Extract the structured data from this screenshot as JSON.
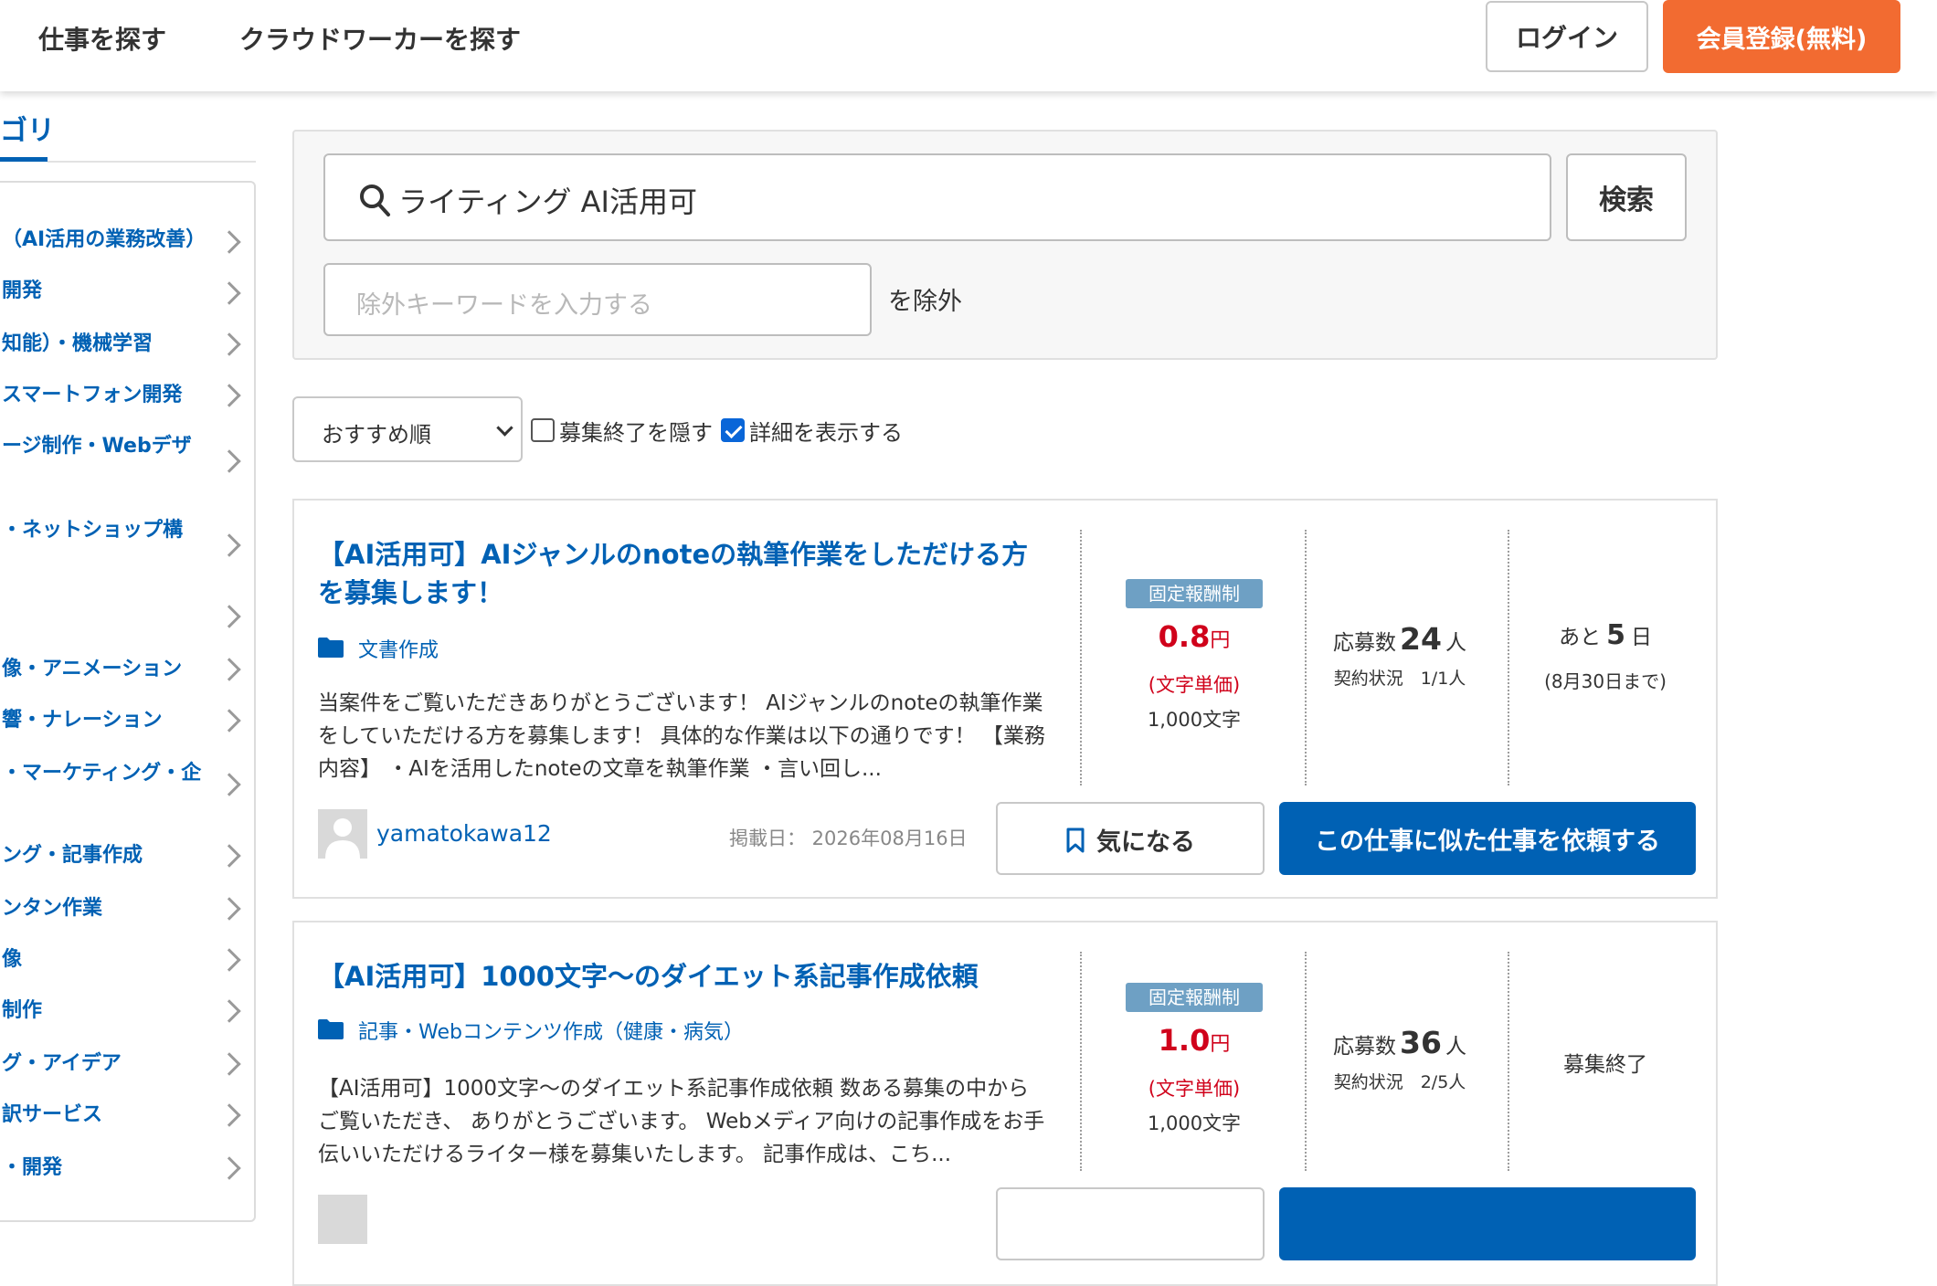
{
  "header": {
    "nav": [
      "仕事を探す",
      "クラウドワーカーを探す"
    ],
    "login_label": "ログイン",
    "register_label": "会員登録(無料)"
  },
  "sidebar": {
    "heading": "ゴリ",
    "items": [
      "（AI活用の業務改善）",
      "開発",
      "知能）・機械学習",
      "スマートフォン開発",
      "ージ制作・Webデザ",
      "・ネットショップ構",
      "",
      "像・アニメーション",
      "響・ナレーション",
      "・マーケティング・企",
      "ング・記事作成",
      "ンタン作業",
      "像",
      "制作",
      "グ・アイデア",
      "訳サービス",
      "・開発"
    ]
  },
  "search": {
    "value": "ライティング AI活用可",
    "button_label": "検索",
    "exclude_placeholder": "除外キーワードを入力する",
    "exclude_suffix": "を除外"
  },
  "filters": {
    "sort_value": "おすすめ順",
    "hide_closed_label": "募集終了を隠す",
    "hide_closed_checked": false,
    "show_details_label": "詳細を表示する",
    "show_details_checked": true
  },
  "jobs": [
    {
      "title": "【AI活用可】AIジャンルのnoteの執筆作業をしただける方を募集します！",
      "category": "文書作成",
      "description": "当案件をご覧いただきありがとうございます！ AIジャンルのnoteの執筆作業をしていただける方を募集します！ 具体的な作業は以下の通りです！ 【業務内容】 ・AIを活用したnoteの文章を執筆作業 ・言い回し...",
      "badge": "固定報酬制",
      "price": "0.8",
      "price_unit": "円",
      "price_type": "(文字単価)",
      "chars": "1,000文字",
      "applicants_label": "応募数",
      "applicants": "24",
      "applicants_unit": "人",
      "contract": "契約状況　1/1人",
      "deadline_prefix": "あと",
      "deadline_days": "5",
      "deadline_suffix": "日",
      "deadline_date": "(8月30日まで)",
      "client": "yamatokawa12",
      "posted": "掲載日： 2026年08月16日",
      "bookmark_label": "気になる",
      "request_label": "この仕事に似た仕事を依頼する"
    },
    {
      "title": "【AI活用可】1000文字〜のダイエット系記事作成依頼",
      "category": "記事・Webコンテンツ作成（健康・病気）",
      "description": "【AI活用可】1000文字〜のダイエット系記事作成依頼 数ある募集の中からご覧いただき、 ありがとうございます。 Webメディア向けの記事作成をお手伝いいただけるライター様を募集いたします。 記事作成は、こち...",
      "badge": "固定報酬制",
      "price": "1.0",
      "price_unit": "円",
      "price_type": "(文字単価)",
      "chars": "1,000文字",
      "applicants_label": "応募数",
      "applicants": "36",
      "applicants_unit": "人",
      "contract": "契約状況　2/5人",
      "status": "募集終了"
    }
  ],
  "colors": {
    "brand_blue": "#0061b4",
    "register_orange": "#f26b31",
    "price_red": "#d0021b",
    "badge_blue": "#6ea0c4"
  }
}
